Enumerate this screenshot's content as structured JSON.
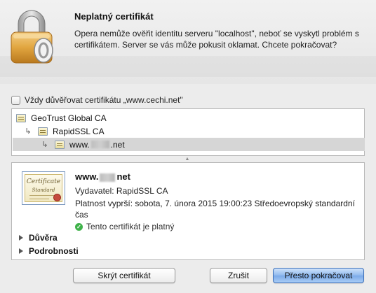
{
  "dialog": {
    "title": "Neplatný certifikát",
    "message": "Opera nemůže ověřit identitu serveru \"localhost\", neboť se vyskytl problém s certifikátem. Server se vás může pokusit oklamat. Chcete pokračovat?",
    "icon": "lock-icon"
  },
  "trust_checkbox": {
    "label": "Vždy důvěřovat certifikátu „www.cechi.net\"",
    "checked": false
  },
  "tree": {
    "items": [
      {
        "label": "GeoTrust Global CA",
        "icon": "certificate-icon"
      },
      {
        "label": "RapidSSL CA",
        "icon": "certificate-icon"
      },
      {
        "label_prefix": "www.",
        "label_suffix": ".net",
        "icon": "certificate-icon",
        "selected": true
      }
    ]
  },
  "details": {
    "name_prefix": "www.",
    "name_suffix": "net",
    "issuer": "Vydavatel: RapidSSL CA",
    "validity": "Platnost vyprší: sobota, 7. února 2015 19:00:23 Středoevropský standardní čas",
    "status": "Tento certifikát je platný",
    "cert_image_title": "Certificate",
    "cert_image_subtitle": "Standard",
    "sections": [
      "Důvěra",
      "Podrobnosti"
    ]
  },
  "buttons": {
    "hide": "Skrýt certifikát",
    "cancel": "Zrušit",
    "continue": "Přesto pokračovat"
  },
  "colors": {
    "valid": "#3fb24a",
    "default_button": "#7aa9e8",
    "selection": "#d6d6d6"
  }
}
